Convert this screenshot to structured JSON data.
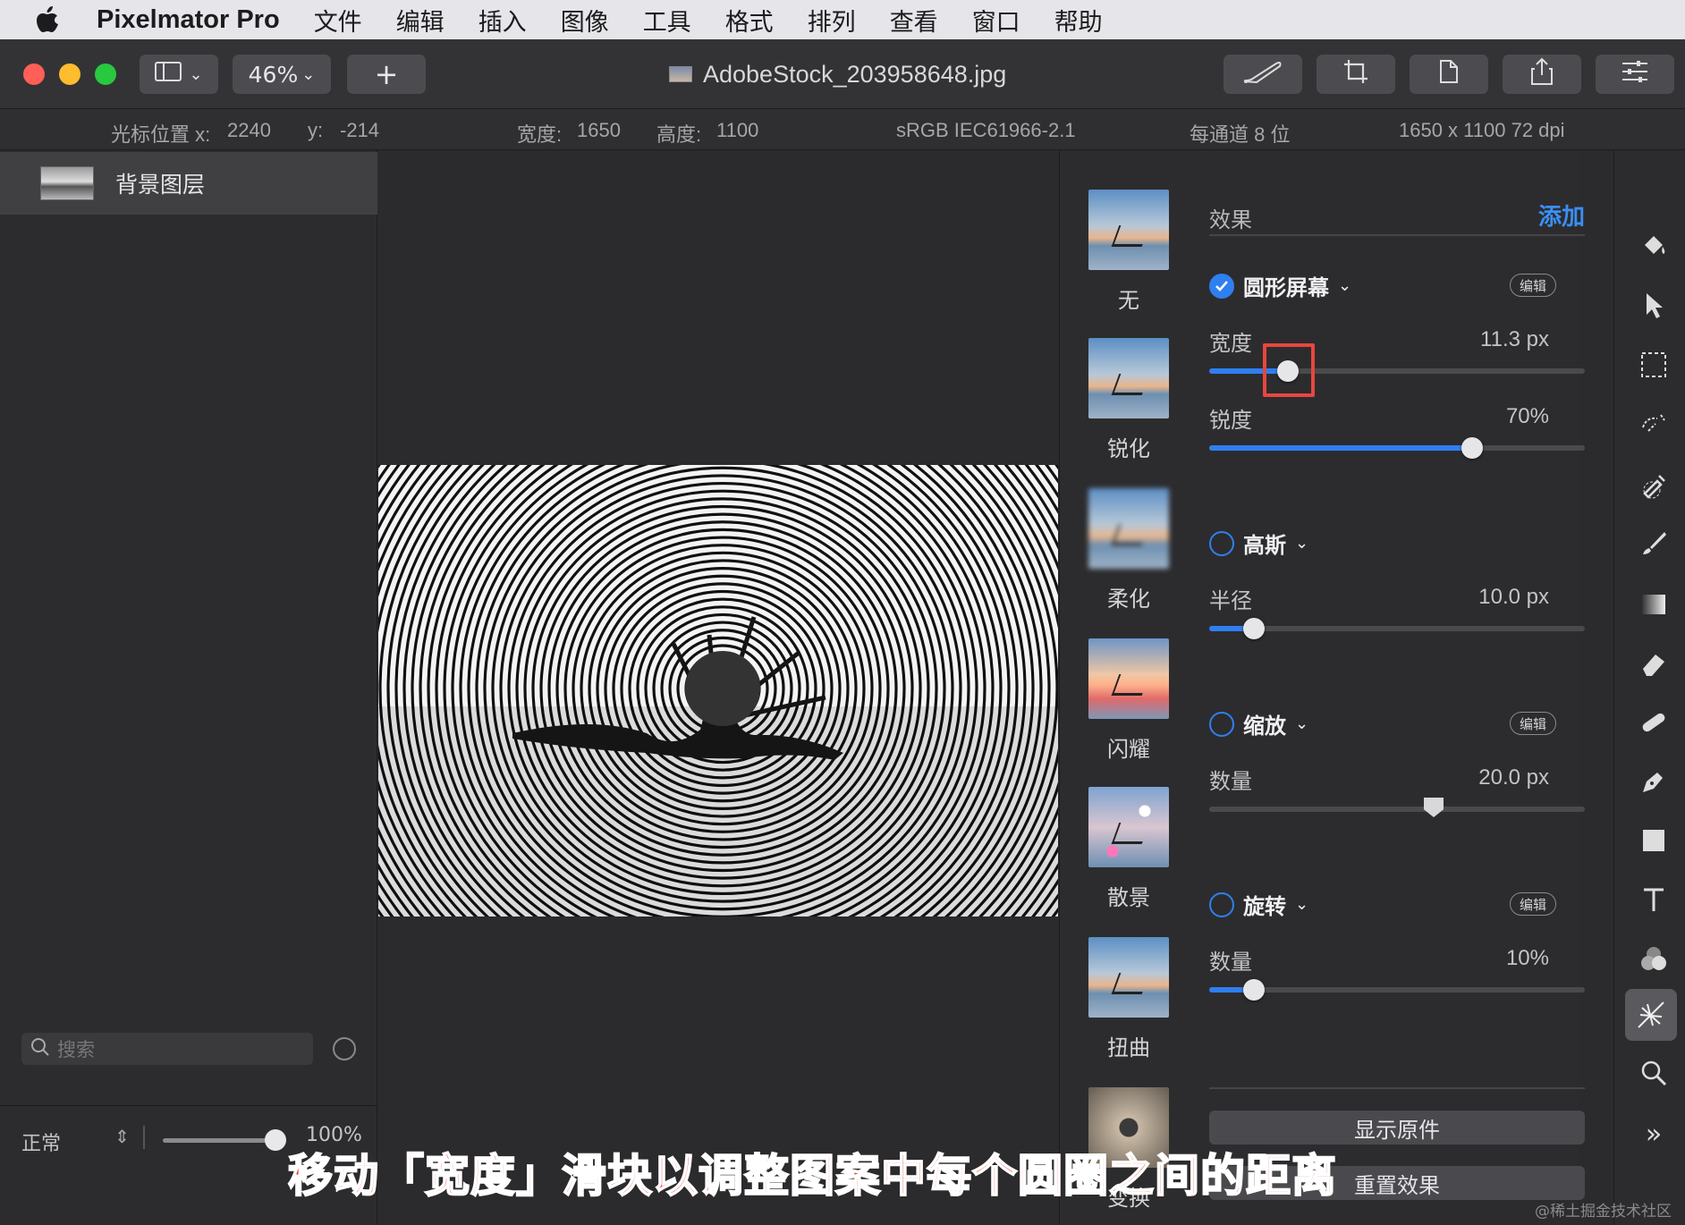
{
  "menubar": {
    "app_name": "Pixelmator Pro",
    "items": [
      "文件",
      "编辑",
      "插入",
      "图像",
      "工具",
      "格式",
      "排列",
      "查看",
      "窗口",
      "帮助"
    ]
  },
  "toolbar": {
    "zoom": "46%",
    "document_title": "AdobeStock_203958648.jpg",
    "add_label": "+"
  },
  "infobar": {
    "cursor_label": "光标位置 x:",
    "cursor_x": "2240",
    "y_label": "y:",
    "cursor_y": "-214",
    "width_label": "宽度:",
    "width_value": "1650",
    "height_label": "高度:",
    "height_value": "1100",
    "color_profile": "sRGB IEC61966-2.1",
    "bit_depth": "每通道 8 位",
    "dimensions": "1650 x 1100 72 dpi"
  },
  "layers": {
    "items": [
      {
        "name": "背景图层"
      }
    ],
    "blend_mode": "正常",
    "opacity": "100%",
    "opacity_fraction": 1.0,
    "search_placeholder": "搜索"
  },
  "effects_browser": {
    "items": [
      {
        "label": "无"
      },
      {
        "label": "锐化"
      },
      {
        "label": "柔化"
      },
      {
        "label": "闪耀"
      },
      {
        "label": "散景"
      },
      {
        "label": "扭曲"
      },
      {
        "label": "变换"
      }
    ]
  },
  "effects_panel": {
    "section_title": "效果",
    "add_label": "添加",
    "edit_label": "编辑",
    "effects": [
      {
        "name": "圆形屏幕",
        "enabled": true,
        "params": [
          {
            "label": "宽度",
            "value": "11.3 px",
            "fraction": 0.21
          },
          {
            "label": "锐度",
            "value": "70%",
            "fraction": 0.7
          }
        ]
      },
      {
        "name": "高斯",
        "enabled": false,
        "params": [
          {
            "label": "半径",
            "value": "10.0 px",
            "fraction": 0.12
          }
        ]
      },
      {
        "name": "缩放",
        "enabled": false,
        "params": [
          {
            "label": "数量",
            "value": "20.0 px",
            "fraction": 0.6
          }
        ]
      },
      {
        "name": "旋转",
        "enabled": false,
        "params": [
          {
            "label": "数量",
            "value": "10%",
            "fraction": 0.12
          }
        ]
      }
    ],
    "show_original": "显示原件",
    "reset_effects": "重置效果"
  },
  "tools": [
    "paint-bucket-icon",
    "arrow-icon",
    "selection-icon",
    "quick-select-icon",
    "color-picker-icon",
    "brush-icon",
    "gradient-icon",
    "eraser-icon",
    "repair-icon",
    "pen-icon",
    "shape-icon",
    "text-icon",
    "color-adjust-icon",
    "effects-icon",
    "zoom-icon",
    "more-icon"
  ],
  "caption": "移动「宽度」滑块以调整图案中每个圆圈之间的距离",
  "watermark": "@稀土掘金技术社区",
  "colors": {
    "accent": "#2f7ff0",
    "highlight": "#e8463f",
    "caption": "#e8413a"
  }
}
